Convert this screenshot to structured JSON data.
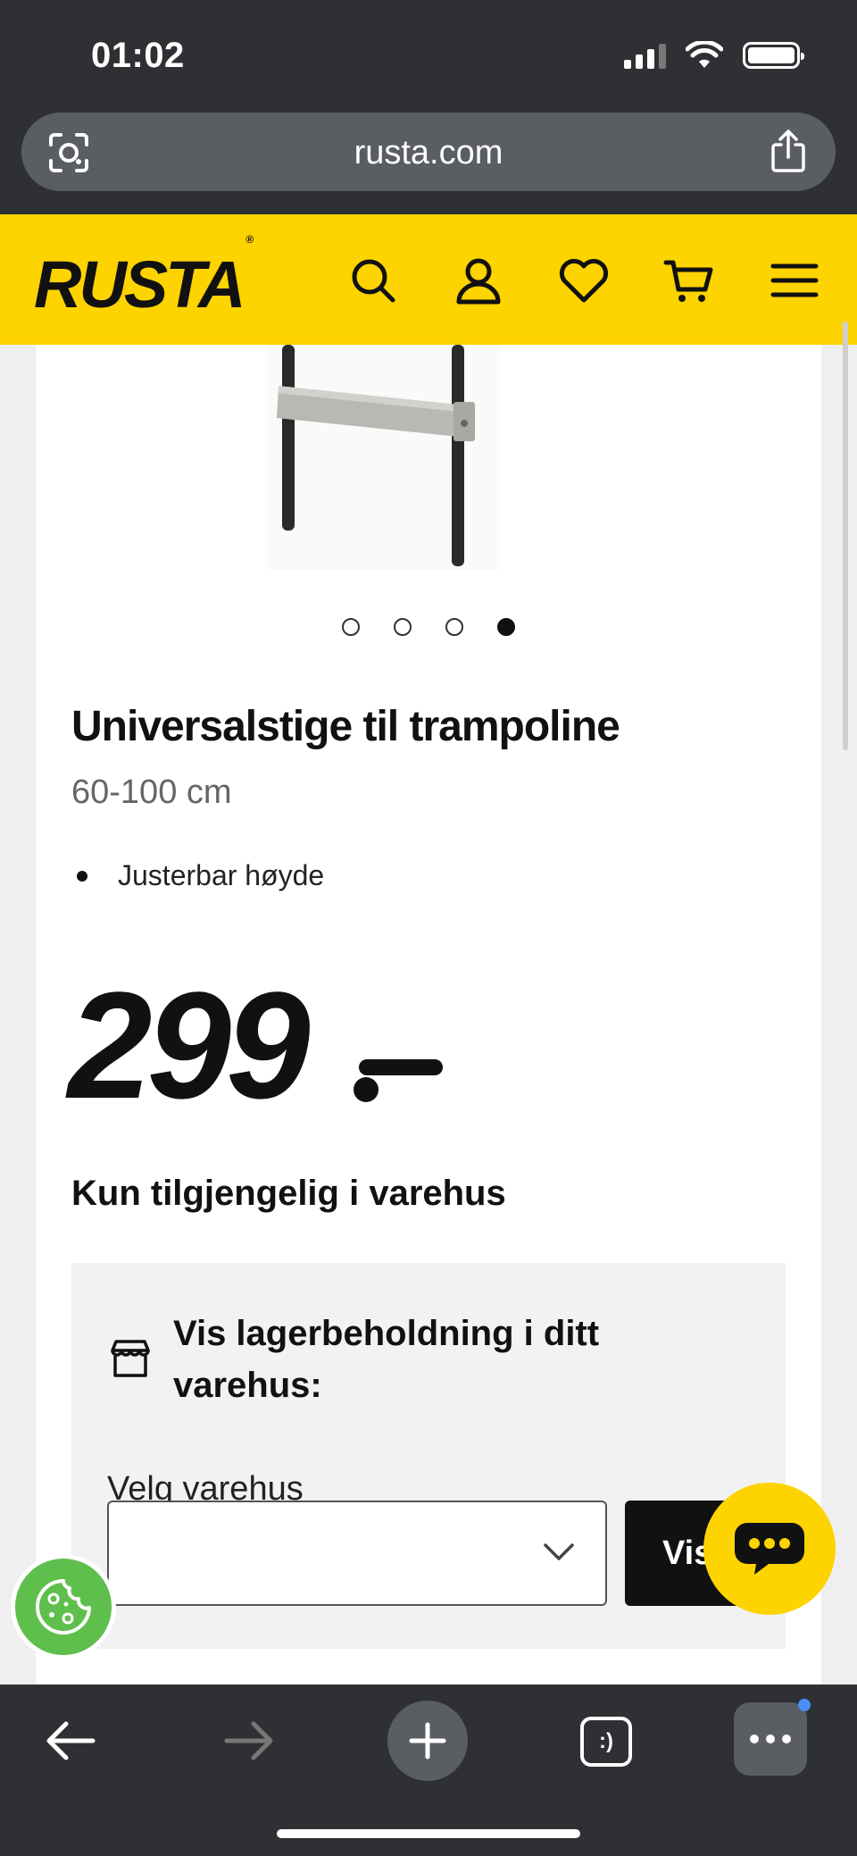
{
  "status_bar": {
    "time": "01:02"
  },
  "browser": {
    "url": "rusta.com"
  },
  "site_header": {
    "logo_text": "RUSTA",
    "logo_mark": "®",
    "icons": [
      "search-icon",
      "user-icon",
      "heart-icon",
      "cart-icon",
      "menu-icon"
    ],
    "brand_color": "#fdd300"
  },
  "product": {
    "image_carousel": {
      "total": 4,
      "active_index": 3
    },
    "title": "Universalstige til trampoline",
    "subtitle": "60-100 cm",
    "features": [
      "Justerbar høyde"
    ],
    "price": "299",
    "availability": "Kun tilgjengelig i varehus"
  },
  "stock": {
    "title": "Vis lagerbeholdning i ditt varehus:",
    "select_label": "Velg varehus",
    "select_value": "",
    "button_label": "Vis"
  },
  "floating": {
    "chat_icon": "chat-icon",
    "cookie_icon": "cookie-icon"
  },
  "toolbar": {
    "icons": [
      "back-arrow-icon",
      "forward-arrow-icon",
      "new-tab-plus-icon",
      "tabs-icon",
      "more-icon"
    ],
    "tabs_glyph": ":)"
  }
}
